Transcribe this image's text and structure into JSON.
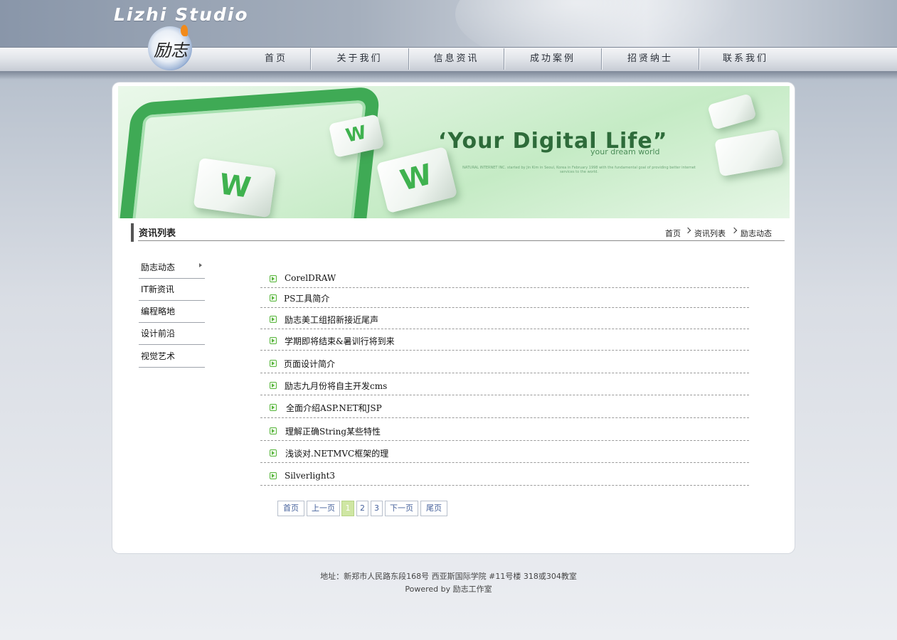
{
  "header": {
    "logo_text": "Lizhi Studio",
    "logo_glyph": "励志",
    "nav": [
      {
        "label": "首页"
      },
      {
        "label": "关于我们"
      },
      {
        "label": "信息资讯"
      },
      {
        "label": "成功案例"
      },
      {
        "label": "招贤纳士"
      },
      {
        "label": "联系我们"
      }
    ]
  },
  "banner": {
    "cube_letter": "W",
    "title": "‘Your Digital Life”",
    "subtitle": "your dream world",
    "fine_print": "NATURAL INTERNET INC. started by Jin Kim in Seoul, Korea in February 1998 with the fundamental goal of providing better internet services to the world."
  },
  "section": {
    "title": "资讯列表",
    "breadcrumb": [
      "首页",
      "资讯列表",
      "励志动态"
    ]
  },
  "sidebar": {
    "items": [
      {
        "label": "励志动态"
      },
      {
        "label": "IT新资讯"
      },
      {
        "label": "编程略地"
      },
      {
        "label": "设计前沿"
      },
      {
        "label": "视觉艺术"
      }
    ]
  },
  "articles": [
    {
      "title": "CorelDRAW"
    },
    {
      "title": "PS工具简介"
    },
    {
      "title": "励志美工组招新接近尾声"
    },
    {
      "title": "学期即将结束&暑训行将到来"
    },
    {
      "title": "页面设计简介"
    },
    {
      "title": "励志九月份将自主开发cms"
    },
    {
      "title": "全面介绍ASP.NET和JSP"
    },
    {
      "title": "理解正确String某些特性"
    },
    {
      "title": "浅谈对.NETMVC框架的理"
    },
    {
      "title": "Silverlight3"
    }
  ],
  "pagination": {
    "first": "首页",
    "prev": "上一页",
    "pages": [
      "1",
      "2",
      "3"
    ],
    "current_page": "1",
    "next": "下一页",
    "last": "尾页"
  },
  "footer": {
    "address": "地址：新郑市人民路东段168号  西亚斯国际学院  #11号楼 318或304教室",
    "powered": "Powered by 励志工作室"
  }
}
